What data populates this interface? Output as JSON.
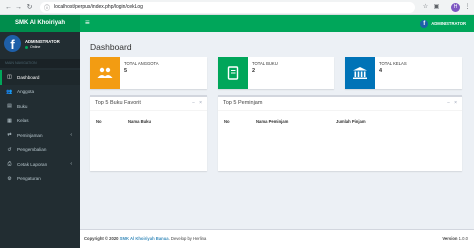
{
  "browser": {
    "url": "localhost/perpus/index.php/login/cekLog",
    "profile_initial": "H"
  },
  "header": {
    "logo": "SMK Al Khoiriyah",
    "user_label": "ADMINISTRATOR"
  },
  "sidebar": {
    "user_name": "ADMINISTRATOR",
    "status": "Online",
    "section": "MAIN NAVIGATION",
    "items": [
      {
        "label": "Dashboard",
        "icon": "dashboard-icon"
      },
      {
        "label": "Anggota",
        "icon": "users-icon"
      },
      {
        "label": "Buku",
        "icon": "book-icon"
      },
      {
        "label": "Kelas",
        "icon": "class-icon"
      },
      {
        "label": "Peminjaman",
        "icon": "loan-icon"
      },
      {
        "label": "Pengembalian",
        "icon": "return-icon"
      },
      {
        "label": "Cetak Laporan",
        "icon": "print-icon"
      },
      {
        "label": "Pengaturan",
        "icon": "gear-icon"
      }
    ]
  },
  "page": {
    "title": "Dashboard"
  },
  "stats": [
    {
      "label": "TOTAL ANGGOTA",
      "value": "5",
      "color": "#f39c12",
      "icon": "users-icon"
    },
    {
      "label": "TOTAL BUKU",
      "value": "2",
      "color": "#00a65a",
      "icon": "book-icon"
    },
    {
      "label": "TOTAL KELAS",
      "value": "4",
      "color": "#0073b7",
      "icon": "building-icon"
    }
  ],
  "boxes": {
    "favorite": {
      "title": "Top 5 Buku Favorit",
      "headers": [
        "No",
        "Nama Buku"
      ]
    },
    "borrowers": {
      "title": "Top 5 Peminjam",
      "headers": [
        "No",
        "Nama Peminjam",
        "Jumlah Pinjam"
      ]
    }
  },
  "footer": {
    "copyright": "Copyright © 2020",
    "org": "SMK Al Khoiriyah Banua",
    "developer": ". Develop by Herlina",
    "version_label": "Version",
    "version": "1.0.0"
  },
  "colors": {
    "header_green": "#00a65a",
    "logo_green": "#008d4c",
    "sidebar": "#222d32"
  }
}
